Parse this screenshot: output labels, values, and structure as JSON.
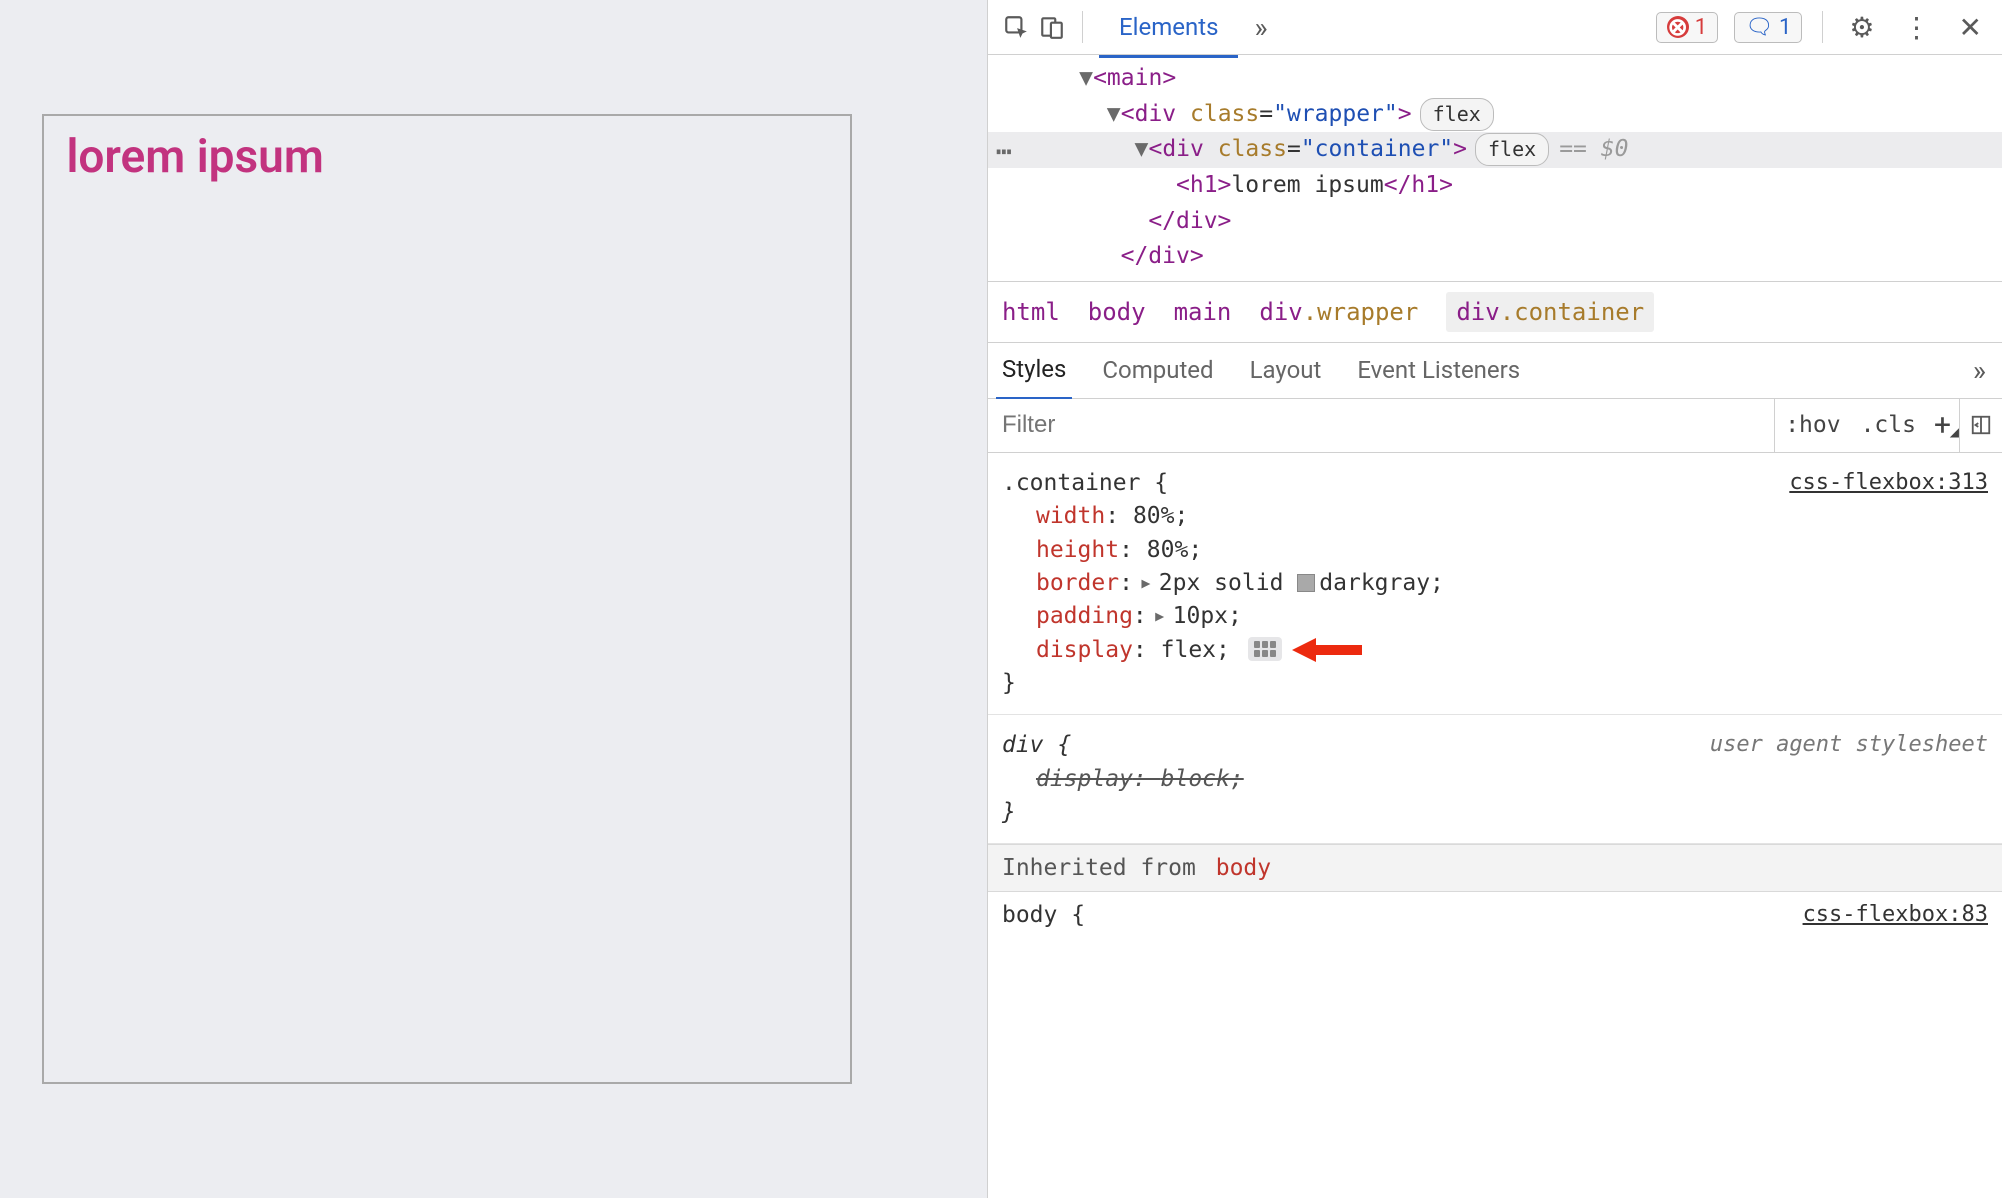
{
  "page": {
    "heading": "lorem ipsum"
  },
  "toolbar": {
    "tab": "Elements",
    "errors_count": "1",
    "issues_count": "1"
  },
  "dom": {
    "main_open": "<main>",
    "wrapper_open_a": "<div ",
    "wrapper_class_attr": "class",
    "wrapper_class_val": "\"wrapper\"",
    "wrapper_open_b": ">",
    "flex_pill": "flex",
    "container_open_a": "<div ",
    "container_class_attr": "class",
    "container_class_val": "\"container\"",
    "container_open_b": ">",
    "dollar": "== $0",
    "h1_open": "<h1>",
    "h1_text": "lorem ipsum",
    "h1_close": "</h1>",
    "div_close": "</div>",
    "div_close2": "</div>"
  },
  "breadcrumb": {
    "html": "html",
    "body": "body",
    "main": "main",
    "wrapper_el": "div",
    "wrapper_cls": ".wrapper",
    "container_el": "div",
    "container_cls": ".container"
  },
  "subtabs": {
    "styles": "Styles",
    "computed": "Computed",
    "layout": "Layout",
    "listeners": "Event Listeners"
  },
  "filter": {
    "placeholder": "Filter",
    "hov": ":hov",
    "cls": ".cls"
  },
  "rule_container": {
    "selector": ".container {",
    "src": "css-flexbox:313",
    "width_p": "width",
    "width_v": "80%;",
    "height_p": "height",
    "height_v": "80%;",
    "border_p": "border",
    "border_v_a": "2px solid ",
    "border_v_b": "darkgray;",
    "padding_p": "padding",
    "padding_v": "10px;",
    "display_p": "display",
    "display_v": "flex;",
    "close": "}"
  },
  "rule_div": {
    "selector": "div {",
    "src": "user agent stylesheet",
    "display_p": "display",
    "display_v": "block;",
    "close": "}"
  },
  "inherited": {
    "label": "Inherited from",
    "from": "body"
  },
  "rule_body": {
    "selector_partial": "body {",
    "src_partial": "css-flexbox:83"
  }
}
